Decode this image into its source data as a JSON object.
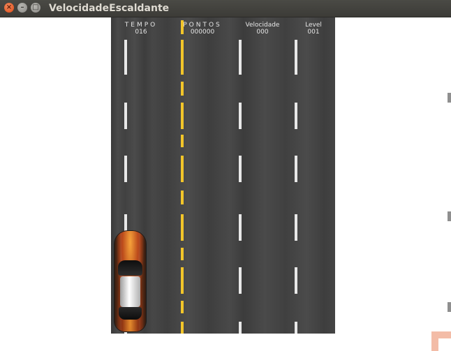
{
  "window": {
    "title": "VelocidadeEscaldante",
    "close_glyph": "×",
    "min_glyph": "–",
    "max_glyph": "□"
  },
  "hud": {
    "tempo_label": "TEMPO",
    "tempo_value": "016",
    "pontos_label": "PONTOS",
    "pontos_value": "000000",
    "velocidade_label": "Velocidade",
    "velocidade_value": "000",
    "level_label": "Level",
    "level_value": "001"
  },
  "colors": {
    "road": "#444444",
    "lane_white": "#e8e8e8",
    "lane_yellow": "#f2c52a",
    "titlebar": "#3c3b37"
  },
  "sprites": {
    "player_car": "flame-car-icon"
  }
}
